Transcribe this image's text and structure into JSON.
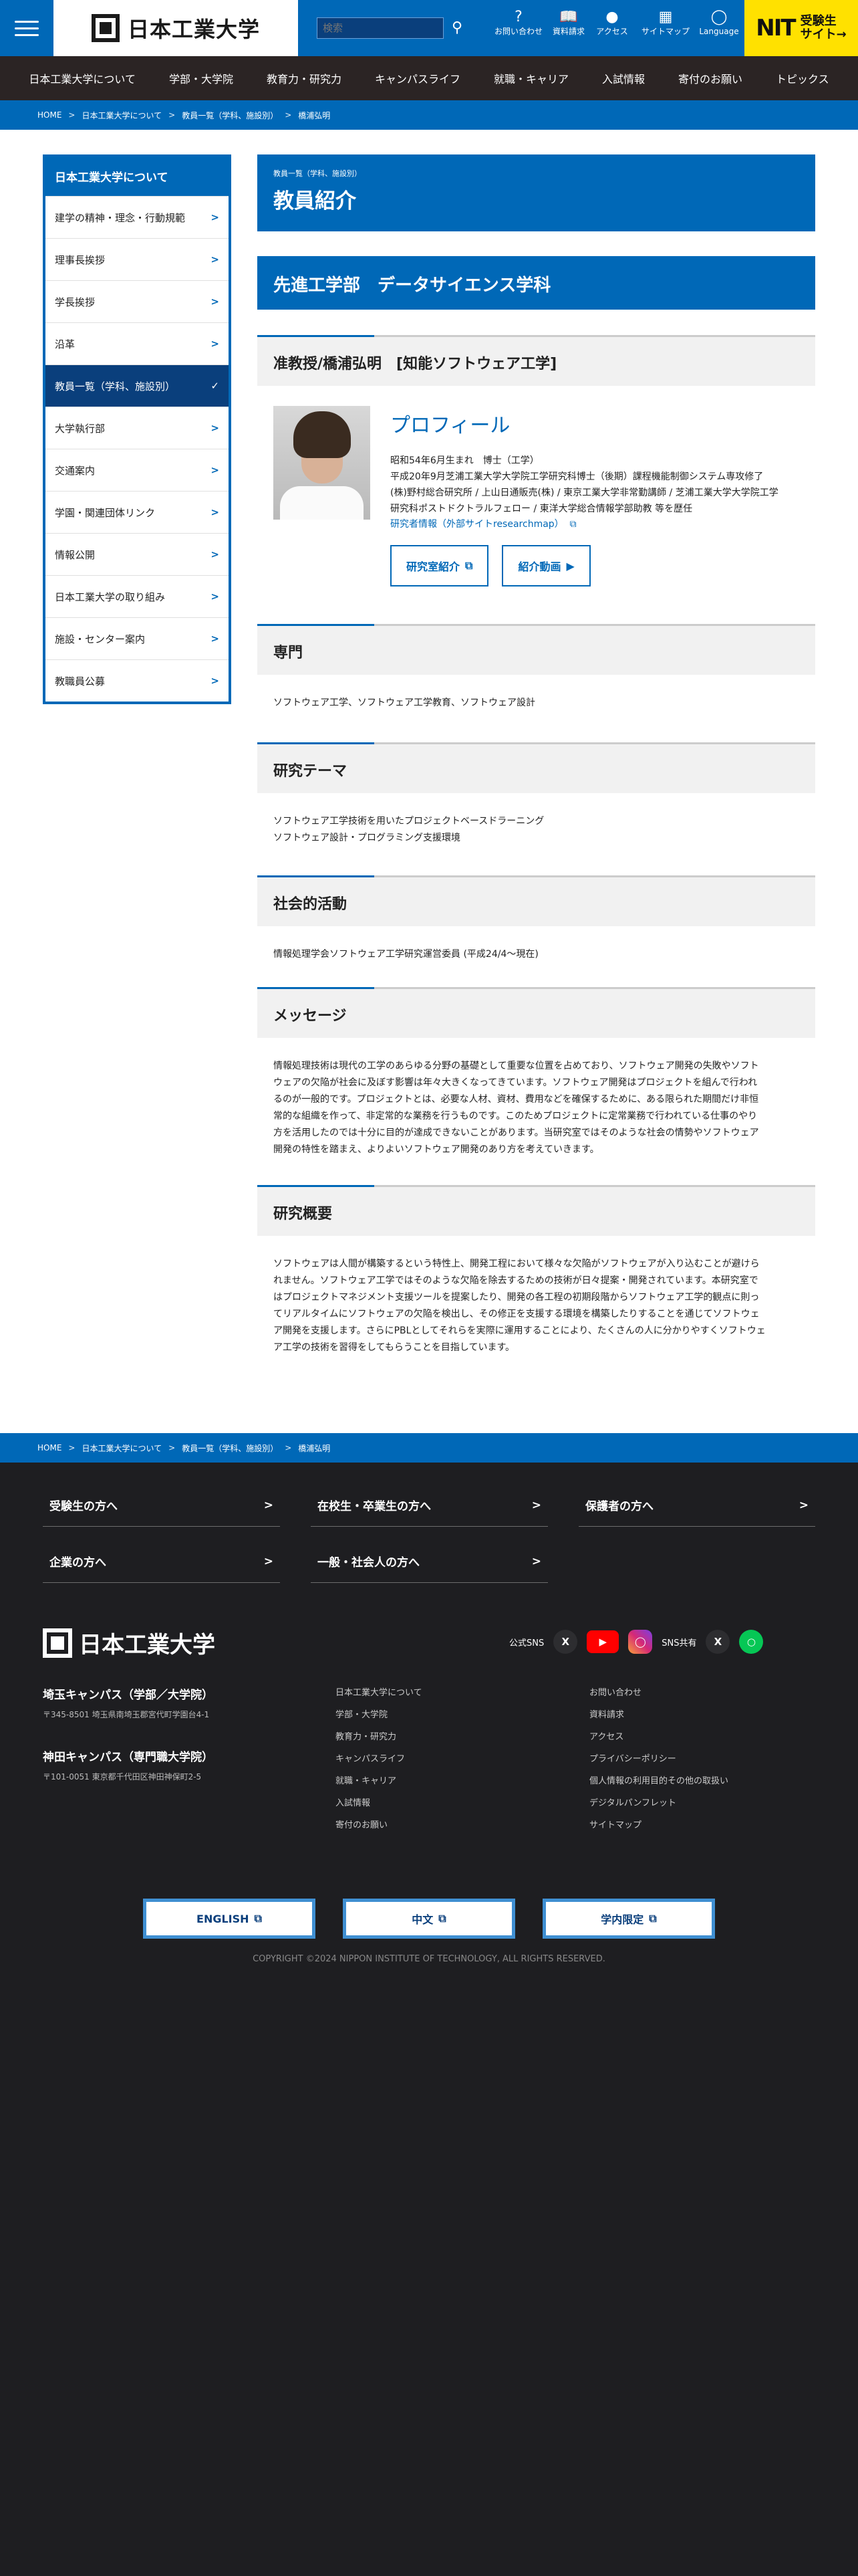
{
  "header": {
    "logo_text": "日本工業大学",
    "search_placeholder": "検索",
    "utilities": [
      {
        "label": "お問い合わせ",
        "icon": "question-icon"
      },
      {
        "label": "資料請求",
        "icon": "book-icon"
      },
      {
        "label": "アクセス",
        "icon": "pin-icon"
      },
      {
        "label": "サイトマップ",
        "icon": "sitemap-icon"
      },
      {
        "label": "Language",
        "icon": "globe-icon"
      }
    ],
    "nit_logo": "NIT",
    "nit_label_1": "受験生",
    "nit_label_2": "サイト",
    "nit_arrow": "→"
  },
  "gnav": [
    "日本工業大学について",
    "学部・大学院",
    "教育力・研究力",
    "キャンパスライフ",
    "就職・キャリア",
    "入試情報",
    "寄付のお願い",
    "トピックス"
  ],
  "breadcrumb": [
    "HOME",
    "日本工業大学について",
    "教員一覧（学科、施設別）",
    "橋浦弘明"
  ],
  "sidebar": {
    "title": "日本工業大学について",
    "items": [
      "建学の精神・理念・行動規範",
      "理事長挨拶",
      "学長挨拶",
      "沿革",
      "教員一覧（学科、施設別）",
      "大学執行部",
      "交通案内",
      "学園・関連団体リンク",
      "情報公開",
      "日本工業大学の取り組み",
      "施設・センター案内",
      "教職員公募"
    ],
    "active_index": 4
  },
  "page": {
    "kicker": "教員一覧（学科、施設別）",
    "title": "教員紹介",
    "department": "先進工学部　データサイエンス学科",
    "faculty_heading": "准教授/橋浦弘明　[知能ソフトウェア工学]",
    "profile_title": "プロフィール",
    "profile_lines": [
      "昭和54年6月生まれ　博士（工学）",
      "平成20年9月芝浦工業大学大学院工学研究科博士（後期）課程機能制御システム専攻修了",
      "(株)野村総合研究所 / 上山日通販売(株) / 東京工業大学非常勤講師 / 芝浦工業大学大学院工学",
      "研究科ポストドクトラルフェロー / 東洋大学総合情報学部助教 等を歴任"
    ],
    "researchmap_link": "研究者情報（外部サイトresearchmap）",
    "btn_lab": "研究室紹介",
    "btn_video": "紹介動画",
    "sections": [
      {
        "title": "専門",
        "body": [
          "ソフトウェア工学、ソフトウェア工学教育、ソフトウェア設計"
        ]
      },
      {
        "title": "研究テーマ",
        "body": [
          "ソフトウェア工学技術を用いたプロジェクトベースドラーニング",
          "ソフトウェア設計・プログラミング支援環境"
        ]
      },
      {
        "title": "社会的活動",
        "body": [
          "情報処理学会ソフトウェア工学研究運営委員 (平成24/4〜現在)"
        ]
      },
      {
        "title": "メッセージ",
        "body": [
          "情報処理技術は現代の工学のあらゆる分野の基礎として重要な位置を占めており、ソフトウェア開発の失敗やソフト",
          "ウェアの欠陥が社会に及ぼす影響は年々大きくなってきています。ソフトウェア開発はプロジェクトを組んで行われ",
          "るのが一般的です。プロジェクトとは、必要な人材、資材、費用などを確保するために、ある限られた期間だけ非恒",
          "常的な組織を作って、非定常的な業務を行うものです。このためプロジェクトに定常業務で行われている仕事のやり",
          "方を活用したのでは十分に目的が達成できないことがあります。当研究室ではそのような社会の情勢やソフトウェア",
          "開発の特性を踏まえ、よりよいソフトウェア開発のあり方を考えていきます。"
        ]
      },
      {
        "title": "研究概要",
        "body": [
          "ソフトウェアは人間が構築するという特性上、開発工程において様々な欠陥がソフトウェアが入り込むことが避けら",
          "れません。ソフトウェア工学ではそのような欠陥を除去するための技術が日々提案・開発されています。本研究室で",
          "はプロジェクトマネジメント支援ツールを提案したり、開発の各工程の初期段階からソフトウェア工学的観点に則っ",
          "てリアルタイムにソフトウェアの欠陥を検出し、その修正を支援する環境を構築したりすることを通じてソフトウェ",
          "ア開発を支援します。さらにPBLとしてそれらを実際に運用することにより、たくさんの人に分かりやすくソフトウェ",
          "ア工学の技術を習得をしてもらうことを目指しています。"
        ]
      }
    ]
  },
  "footer": {
    "audience_links": [
      "受験生の方へ",
      "在校生・卒業生の方へ",
      "保護者の方へ",
      "企業の方へ",
      "一般・社会人の方へ"
    ],
    "logo_text": "日本工業大学",
    "official_sns_label": "公式SNS",
    "sns_share_label": "SNS共有",
    "campuses": [
      {
        "name": "埼玉キャンパス（学部／大学院）",
        "address": "〒345-8501 埼玉県南埼玉郡宮代町学園台4-1"
      },
      {
        "name": "神田キャンパス（専門職大学院）",
        "address": "〒101-0051 東京都千代田区神田神保町2-5"
      }
    ],
    "col1": [
      "日本工業大学について",
      "学部・大学院",
      "教育力・研究力",
      "キャンパスライフ",
      "就職・キャリア",
      "入試情報",
      "寄付のお願い"
    ],
    "col2": [
      "お問い合わせ",
      "資料請求",
      "アクセス",
      "プライバシーポリシー",
      "個人情報の利用目的その他の取扱い",
      "デジタルパンフレット",
      "サイトマップ"
    ],
    "lang_buttons": [
      "ENGLISH",
      "中文",
      "学内限定"
    ],
    "copyright": "COPYRIGHT ©2024 NIPPON INSTITUTE OF TECHNOLOGY, ALL RIGHTS RESERVED."
  },
  "colors": {
    "primary": "#0068b7",
    "dark_nav": "#2b2424",
    "footer_bg": "#1e1e21",
    "nit_yellow": "#ffe100"
  }
}
